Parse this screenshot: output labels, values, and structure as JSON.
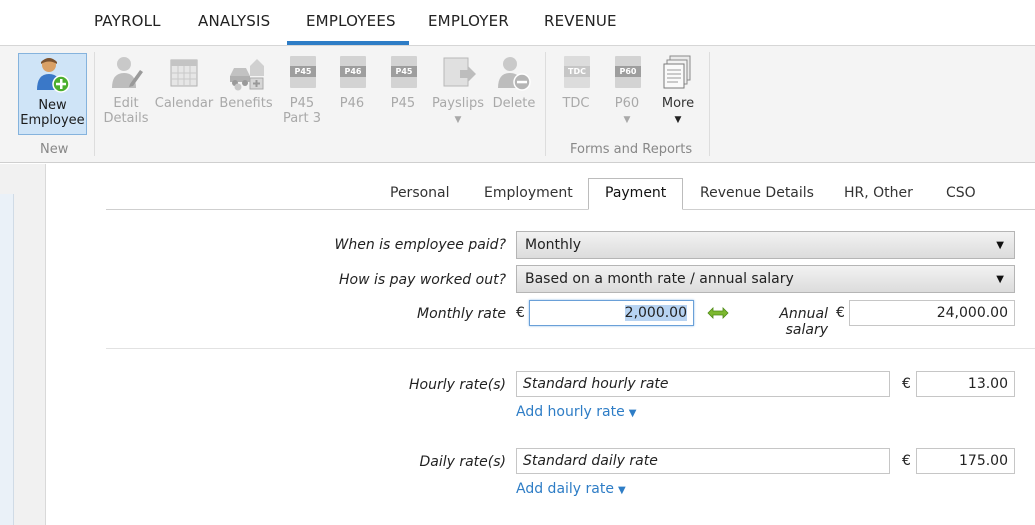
{
  "top_menu": {
    "items": [
      {
        "label": "PAYROLL"
      },
      {
        "label": "ANALYSIS"
      },
      {
        "label": "EMPLOYEES",
        "active": true
      },
      {
        "label": "EMPLOYER"
      },
      {
        "label": "REVENUE"
      }
    ],
    "accent_color": "#2e7dc6"
  },
  "ribbon": {
    "new_group": {
      "new_employee_label": "New\nEmployee",
      "group_label": "New"
    },
    "buttons": {
      "edit_details": "Edit\nDetails",
      "calendar": "Calendar",
      "benefits": "Benefits",
      "p45_part3": "P45\nPart 3",
      "p46": "P46",
      "p45": "P45",
      "payslips": "Payslips",
      "delete": "Delete"
    },
    "forms_group": {
      "tdc": "TDC",
      "p60": "P60",
      "more": "More",
      "group_label": "Forms and Reports"
    },
    "doc_badges": {
      "p45": "P45",
      "p46": "P46",
      "tdc": "TDC",
      "p60": "P60"
    }
  },
  "tabs": [
    {
      "label": "Personal"
    },
    {
      "label": "Employment"
    },
    {
      "label": "Payment",
      "active": true
    },
    {
      "label": "Revenue Details"
    },
    {
      "label": "HR, Other"
    },
    {
      "label": "CSO"
    }
  ],
  "form": {
    "when_paid": {
      "label": "When is employee paid?",
      "value": "Monthly"
    },
    "how_worked": {
      "label": "How is pay worked out?",
      "value": "Based on a month rate / annual salary"
    },
    "monthly_rate": {
      "label": "Monthly rate",
      "currency": "€",
      "value": "2,000.00"
    },
    "annual_salary": {
      "label": "Annual salary",
      "currency": "€",
      "value": "24,000.00"
    },
    "hourly": {
      "label": "Hourly rate(s)",
      "name": "Standard hourly rate",
      "currency": "€",
      "value": "13.00",
      "add_link": "Add hourly rate"
    },
    "daily": {
      "label": "Daily rate(s)",
      "name": "Standard daily rate",
      "currency": "€",
      "value": "175.00",
      "add_link": "Add daily rate"
    }
  }
}
